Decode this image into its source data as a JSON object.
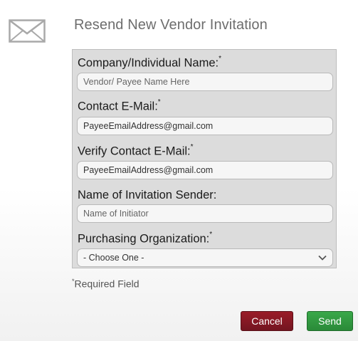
{
  "dialog": {
    "title": "Resend New Vendor Invitation",
    "icon": "envelope-icon"
  },
  "form": {
    "company": {
      "label": "Company/Individual Name:",
      "required_mark": "*",
      "placeholder": "Vendor/ Payee Name Here"
    },
    "email": {
      "label": "Contact E-Mail:",
      "required_mark": "*",
      "value": "PayeeEmailAddress@gmail.com"
    },
    "verify_email": {
      "label": "Verify Contact E-Mail:",
      "required_mark": "*",
      "value": "PayeeEmailAddress@gmail.com"
    },
    "sender": {
      "label": "Name of Invitation Sender:",
      "placeholder": "Name of Initiator"
    },
    "org": {
      "label": "Purchasing Organization:",
      "required_mark": "*",
      "selected": "- Choose One -"
    }
  },
  "required_note": {
    "mark": "*",
    "text": "Required Field"
  },
  "buttons": {
    "cancel": "Cancel",
    "send": "Send"
  },
  "colors": {
    "cancel": "#8a1924",
    "send": "#33a043",
    "form_bg": "#dcdcdc"
  }
}
